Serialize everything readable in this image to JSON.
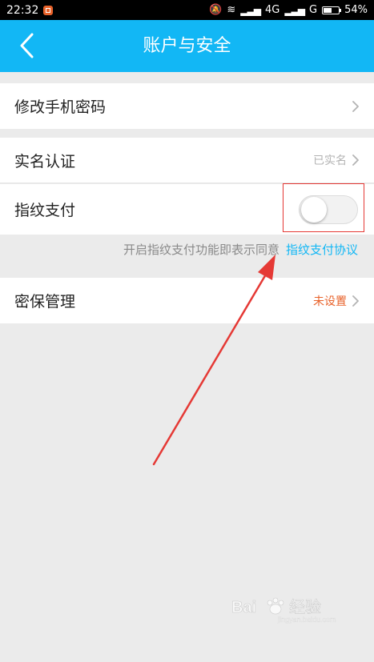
{
  "status_bar": {
    "time": "22:32",
    "network": "4G",
    "network2": "G",
    "battery_percent": "54%",
    "battery_level": 0.54
  },
  "header": {
    "title": "账户与安全",
    "back_icon": "chevron-left-icon",
    "color": "#12b7f5"
  },
  "rows": {
    "change_password": {
      "label": "修改手机密码"
    },
    "real_name": {
      "label": "实名认证",
      "value": "已实名"
    },
    "fingerprint_pay": {
      "label": "指纹支付",
      "toggle_on": false
    },
    "security_question": {
      "label": "密保管理",
      "value": "未设置"
    }
  },
  "agreement": {
    "text": "开启指纹支付功能即表示同意",
    "link": "指纹支付协议"
  },
  "annotation": {
    "arrow_color": "#e53935",
    "box_color": "#e53935"
  },
  "watermark": {
    "text": "Bai 经验",
    "url": "jingyan.baidu.com"
  }
}
